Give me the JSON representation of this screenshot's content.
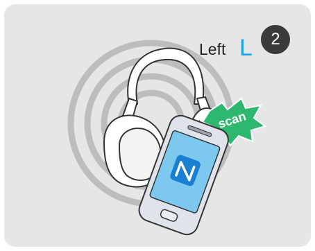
{
  "step": {
    "number": "2"
  },
  "side": {
    "label": "Left",
    "letter": "L"
  },
  "burst": {
    "text": "scan"
  },
  "colors": {
    "card_bg": "#e6e6e6",
    "ring": "#bdbdbd",
    "badge_bg": "#3a3a3a",
    "accent_blue": "#1aa3e8",
    "burst_green": "#2eb86f"
  },
  "icons": [
    "headphones-icon",
    "smartphone-icon",
    "nfc-icon"
  ]
}
